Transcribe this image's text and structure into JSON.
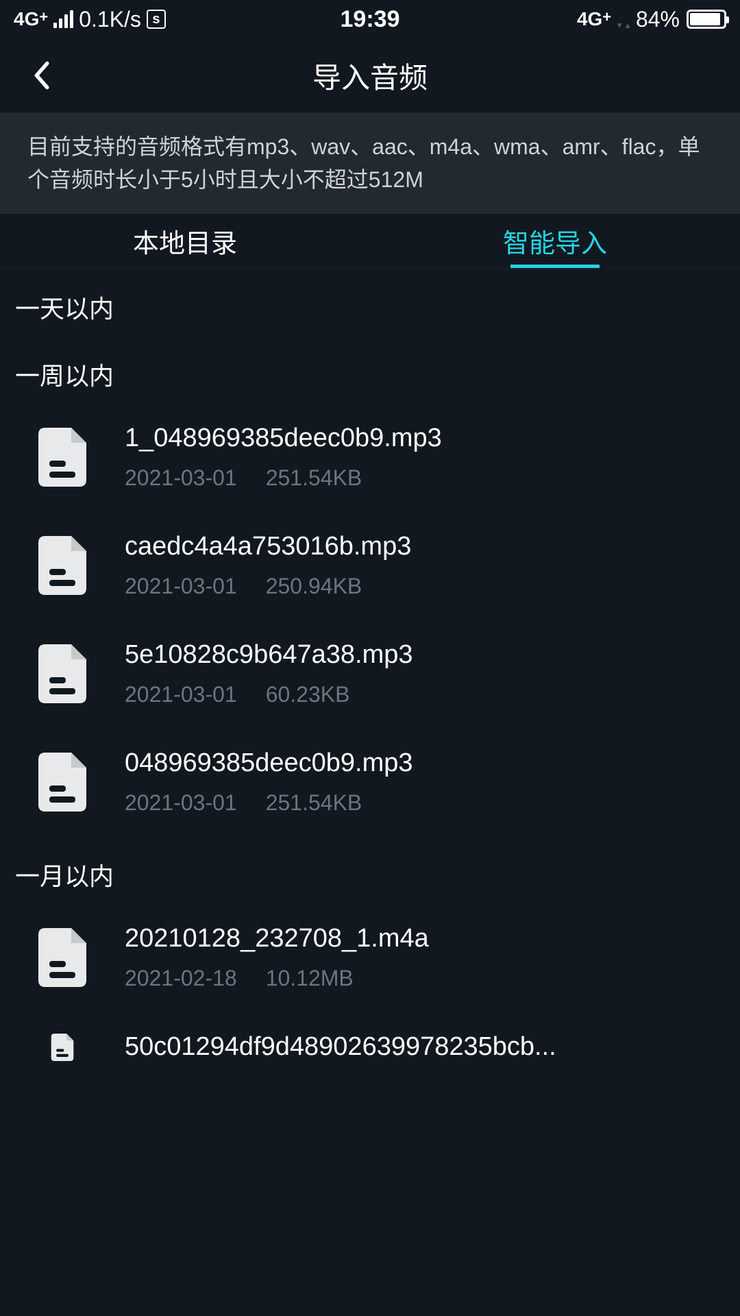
{
  "status_bar": {
    "network_type": "4G+",
    "data_speed": "0.1K/s",
    "sim_label": "s",
    "time": "19:39",
    "network_type_right": "4G+",
    "battery_percent": "84%"
  },
  "header": {
    "title": "导入音频"
  },
  "info_banner": "目前支持的音频格式有mp3、wav、aac、m4a、wma、amr、flac，单个音频时长小于5小时且大小不超过512M",
  "tabs": {
    "local": "本地目录",
    "smart": "智能导入"
  },
  "sections": [
    {
      "label": "一天以内",
      "files": []
    },
    {
      "label": "一周以内",
      "files": [
        {
          "name": "1_048969385deec0b9.mp3",
          "date": "2021-03-01",
          "size": "251.54KB"
        },
        {
          "name": "caedc4a4a753016b.mp3",
          "date": "2021-03-01",
          "size": "250.94KB"
        },
        {
          "name": "5e10828c9b647a38.mp3",
          "date": "2021-03-01",
          "size": "60.23KB"
        },
        {
          "name": "048969385deec0b9.mp3",
          "date": "2021-03-01",
          "size": "251.54KB"
        }
      ]
    },
    {
      "label": "一月以内",
      "files": [
        {
          "name": "20210128_232708_1.m4a",
          "date": "2021-02-18",
          "size": "10.12MB"
        },
        {
          "name": "50c01294df9d48902639978235bcb...",
          "date": "",
          "size": ""
        }
      ]
    }
  ]
}
